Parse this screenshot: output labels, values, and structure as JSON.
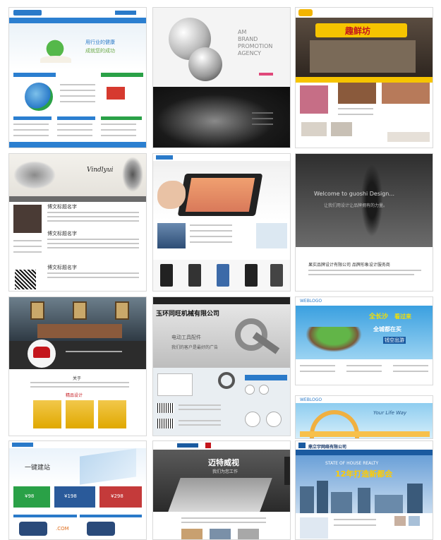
{
  "tiles": {
    "t1": {
      "banner_line1": "用行业的健康",
      "banner_line2": "成就您的成功"
    },
    "t2": {
      "brand_line1": "AM",
      "brand_line2": "BRAND",
      "brand_line3": "PROMOTION",
      "brand_line4": "AGENCY"
    },
    "t3": {
      "shop_sign": "趣鲜坊"
    },
    "t4": {
      "ink_title": "Vindlyui",
      "post_title_1": "博文标题名字",
      "post_title_2": "博文标题名字",
      "post_title_3": "博文标题名字"
    },
    "t6": {
      "welcome": "Welcome to guoshi Design...",
      "subline": "让我们用设计让品牌拥有的力量。",
      "headline": "果实品牌设计有限公司 品牌形象设计服务商"
    },
    "t7": {
      "section_title": "关于",
      "section_title_2": "精品设计"
    },
    "t8": {
      "company": "玉环同旺机械有限公司",
      "tagline": "电动工具配件",
      "sub": "我们的客户是最好的广告"
    },
    "t9": {
      "logo": "WEBLOGO",
      "slogan_1": "全长沙",
      "slogan_2": "看过来",
      "slogan_3": "全城都在买",
      "slogan_4": "钱空出游"
    },
    "t10": {
      "logo": "WEBLOGO",
      "slogan": "Your Life Way"
    },
    "t11": {
      "hero": "一键建站",
      "price_1": "¥98",
      "price_2": "¥198",
      "price_3": "¥298",
      "domain": ".COM"
    },
    "t12": {
      "hero": "迈特威视",
      "hero_sub": "我们为您工作"
    },
    "t13": {
      "company": "鼎立宇网络有限公司",
      "banner_en": "STATE OF HOUSE REALTY",
      "banner_big": "12年打造新都会"
    }
  },
  "colors": {
    "green": "#2aa147",
    "blue": "#1a74c4",
    "yellow": "#f2c84b",
    "dark": "#1c1c1c",
    "gray": "#7d7d7d"
  }
}
